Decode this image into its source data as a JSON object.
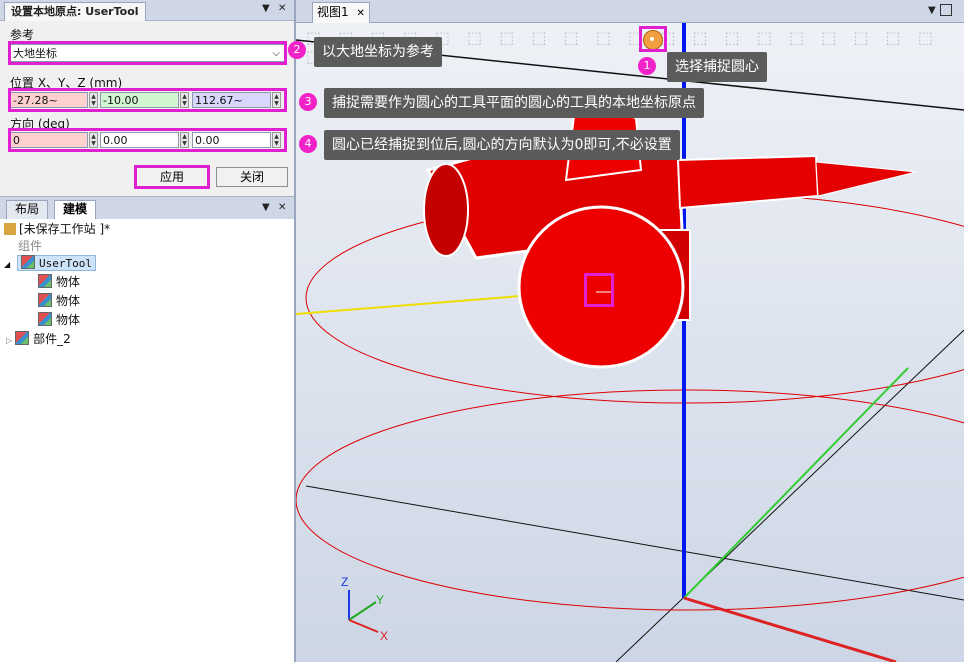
{
  "left_panel": {
    "title": "设置本地原点: UserTool",
    "pin_glyph": "▼",
    "close_glyph": "✕",
    "reference_label": "参考",
    "reference_value": "大地坐标",
    "position_label": "位置 X、Y、Z (mm)",
    "position": [
      "-27.28~",
      "-10.00",
      "112.67~"
    ],
    "orientation_label": "方向 (deg)",
    "orientation": [
      "0",
      "0.00",
      "0.00"
    ],
    "apply_label": "应用",
    "close_label": "关闭"
  },
  "bottom_panel": {
    "tabs": [
      "布局",
      "建模"
    ],
    "station": "[未保存工作站 ]*",
    "group": "组件",
    "items": [
      {
        "label": "UserTool"
      },
      {
        "label": "物体"
      },
      {
        "label": "物体"
      },
      {
        "label": "物体"
      },
      {
        "label": "部件_2"
      }
    ]
  },
  "view": {
    "tab_label": "视图1",
    "close_glyph": "✕"
  },
  "callouts": [
    {
      "num": "1",
      "text": "选择捕捉圆心"
    },
    {
      "num": "2",
      "text": "以大地坐标为参考"
    },
    {
      "num": "3",
      "text": "捕捉需要作为圆心的工具平面的圆心的工具的本地坐标原点"
    },
    {
      "num": "4",
      "text": "圆心已经捕捉到位后,圆心的方向默认为0即可,不必设置"
    }
  ],
  "axes": {
    "x": "X",
    "y": "Y",
    "z": "Z"
  }
}
